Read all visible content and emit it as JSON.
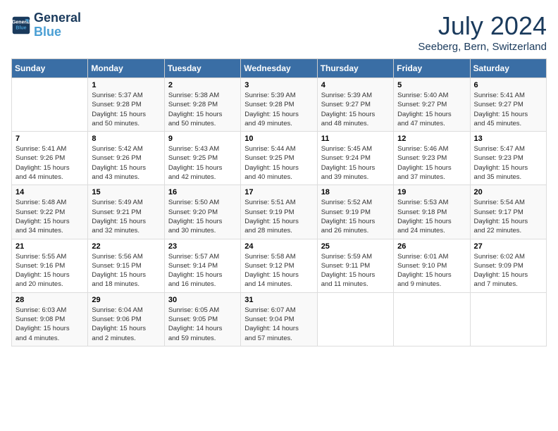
{
  "logo": {
    "line1": "General",
    "line2": "Blue"
  },
  "title": "July 2024",
  "subtitle": "Seeberg, Bern, Switzerland",
  "days_of_week": [
    "Sunday",
    "Monday",
    "Tuesday",
    "Wednesday",
    "Thursday",
    "Friday",
    "Saturday"
  ],
  "weeks": [
    [
      {
        "day": "",
        "info": ""
      },
      {
        "day": "1",
        "info": "Sunrise: 5:37 AM\nSunset: 9:28 PM\nDaylight: 15 hours\nand 50 minutes."
      },
      {
        "day": "2",
        "info": "Sunrise: 5:38 AM\nSunset: 9:28 PM\nDaylight: 15 hours\nand 50 minutes."
      },
      {
        "day": "3",
        "info": "Sunrise: 5:39 AM\nSunset: 9:28 PM\nDaylight: 15 hours\nand 49 minutes."
      },
      {
        "day": "4",
        "info": "Sunrise: 5:39 AM\nSunset: 9:27 PM\nDaylight: 15 hours\nand 48 minutes."
      },
      {
        "day": "5",
        "info": "Sunrise: 5:40 AM\nSunset: 9:27 PM\nDaylight: 15 hours\nand 47 minutes."
      },
      {
        "day": "6",
        "info": "Sunrise: 5:41 AM\nSunset: 9:27 PM\nDaylight: 15 hours\nand 45 minutes."
      }
    ],
    [
      {
        "day": "7",
        "info": "Sunrise: 5:41 AM\nSunset: 9:26 PM\nDaylight: 15 hours\nand 44 minutes."
      },
      {
        "day": "8",
        "info": "Sunrise: 5:42 AM\nSunset: 9:26 PM\nDaylight: 15 hours\nand 43 minutes."
      },
      {
        "day": "9",
        "info": "Sunrise: 5:43 AM\nSunset: 9:25 PM\nDaylight: 15 hours\nand 42 minutes."
      },
      {
        "day": "10",
        "info": "Sunrise: 5:44 AM\nSunset: 9:25 PM\nDaylight: 15 hours\nand 40 minutes."
      },
      {
        "day": "11",
        "info": "Sunrise: 5:45 AM\nSunset: 9:24 PM\nDaylight: 15 hours\nand 39 minutes."
      },
      {
        "day": "12",
        "info": "Sunrise: 5:46 AM\nSunset: 9:23 PM\nDaylight: 15 hours\nand 37 minutes."
      },
      {
        "day": "13",
        "info": "Sunrise: 5:47 AM\nSunset: 9:23 PM\nDaylight: 15 hours\nand 35 minutes."
      }
    ],
    [
      {
        "day": "14",
        "info": "Sunrise: 5:48 AM\nSunset: 9:22 PM\nDaylight: 15 hours\nand 34 minutes."
      },
      {
        "day": "15",
        "info": "Sunrise: 5:49 AM\nSunset: 9:21 PM\nDaylight: 15 hours\nand 32 minutes."
      },
      {
        "day": "16",
        "info": "Sunrise: 5:50 AM\nSunset: 9:20 PM\nDaylight: 15 hours\nand 30 minutes."
      },
      {
        "day": "17",
        "info": "Sunrise: 5:51 AM\nSunset: 9:19 PM\nDaylight: 15 hours\nand 28 minutes."
      },
      {
        "day": "18",
        "info": "Sunrise: 5:52 AM\nSunset: 9:19 PM\nDaylight: 15 hours\nand 26 minutes."
      },
      {
        "day": "19",
        "info": "Sunrise: 5:53 AM\nSunset: 9:18 PM\nDaylight: 15 hours\nand 24 minutes."
      },
      {
        "day": "20",
        "info": "Sunrise: 5:54 AM\nSunset: 9:17 PM\nDaylight: 15 hours\nand 22 minutes."
      }
    ],
    [
      {
        "day": "21",
        "info": "Sunrise: 5:55 AM\nSunset: 9:16 PM\nDaylight: 15 hours\nand 20 minutes."
      },
      {
        "day": "22",
        "info": "Sunrise: 5:56 AM\nSunset: 9:15 PM\nDaylight: 15 hours\nand 18 minutes."
      },
      {
        "day": "23",
        "info": "Sunrise: 5:57 AM\nSunset: 9:14 PM\nDaylight: 15 hours\nand 16 minutes."
      },
      {
        "day": "24",
        "info": "Sunrise: 5:58 AM\nSunset: 9:12 PM\nDaylight: 15 hours\nand 14 minutes."
      },
      {
        "day": "25",
        "info": "Sunrise: 5:59 AM\nSunset: 9:11 PM\nDaylight: 15 hours\nand 11 minutes."
      },
      {
        "day": "26",
        "info": "Sunrise: 6:01 AM\nSunset: 9:10 PM\nDaylight: 15 hours\nand 9 minutes."
      },
      {
        "day": "27",
        "info": "Sunrise: 6:02 AM\nSunset: 9:09 PM\nDaylight: 15 hours\nand 7 minutes."
      }
    ],
    [
      {
        "day": "28",
        "info": "Sunrise: 6:03 AM\nSunset: 9:08 PM\nDaylight: 15 hours\nand 4 minutes."
      },
      {
        "day": "29",
        "info": "Sunrise: 6:04 AM\nSunset: 9:06 PM\nDaylight: 15 hours\nand 2 minutes."
      },
      {
        "day": "30",
        "info": "Sunrise: 6:05 AM\nSunset: 9:05 PM\nDaylight: 14 hours\nand 59 minutes."
      },
      {
        "day": "31",
        "info": "Sunrise: 6:07 AM\nSunset: 9:04 PM\nDaylight: 14 hours\nand 57 minutes."
      },
      {
        "day": "",
        "info": ""
      },
      {
        "day": "",
        "info": ""
      },
      {
        "day": "",
        "info": ""
      }
    ]
  ]
}
